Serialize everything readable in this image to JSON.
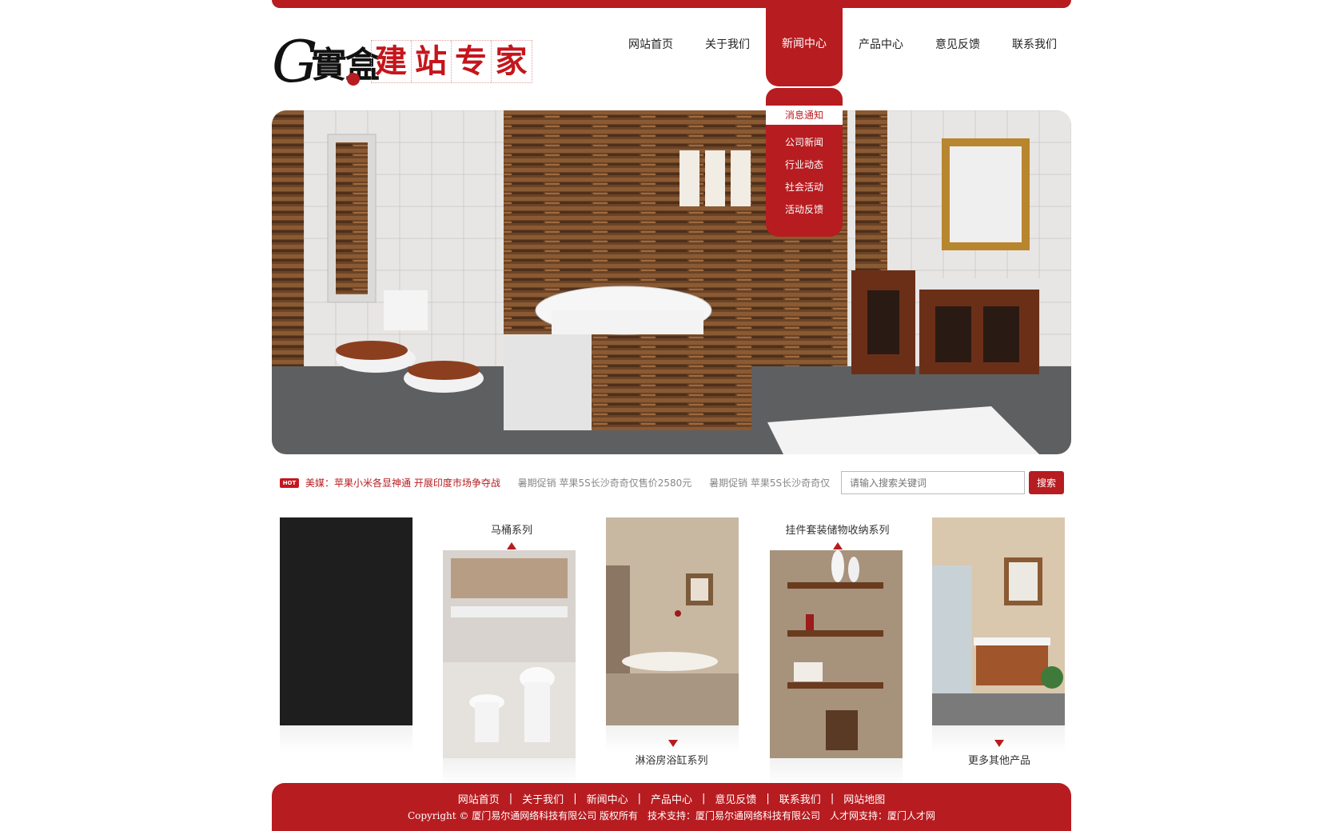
{
  "logo": {
    "letter": "G",
    "hanzi": "實盒",
    "slogan": [
      "建",
      "站",
      "专",
      "家"
    ]
  },
  "nav": {
    "items": [
      "网站首页",
      "关于我们",
      "新闻中心",
      "产品中心",
      "意见反馈",
      "联系我们"
    ],
    "active_index": 2
  },
  "submenu": {
    "first": "消息通知",
    "items": [
      "公司新闻",
      "行业动态",
      "社会活动",
      "活动反馈"
    ]
  },
  "ticker": {
    "hot_badge": "HOT",
    "item1": "美媒：苹果小米各显神通 开展印度市场争夺战",
    "item2": "暑期促销 苹果5S长沙奇奇仅售价2580元",
    "item3": "暑期促销 苹果5S长沙奇奇仅"
  },
  "search": {
    "placeholder": "请输入搜索关键词",
    "button": "搜索"
  },
  "products": {
    "p2_label": "马桶系列",
    "p3_label": "淋浴房浴缸系列",
    "p4_label": "挂件套装储物收纳系列",
    "p5_label": "更多其他产品"
  },
  "footer": {
    "links": [
      "网站首页",
      "关于我们",
      "新闻中心",
      "产品中心",
      "意见反馈",
      "联系我们",
      "网站地图"
    ],
    "copyright": "Copyright © 厦门易尔通网络科技有限公司 版权所有　技术支持：厦门易尔通网络科技有限公司　人才网支持：厦门人才网"
  },
  "colors": {
    "brand_red": "#b71c20",
    "text": "#333333"
  }
}
